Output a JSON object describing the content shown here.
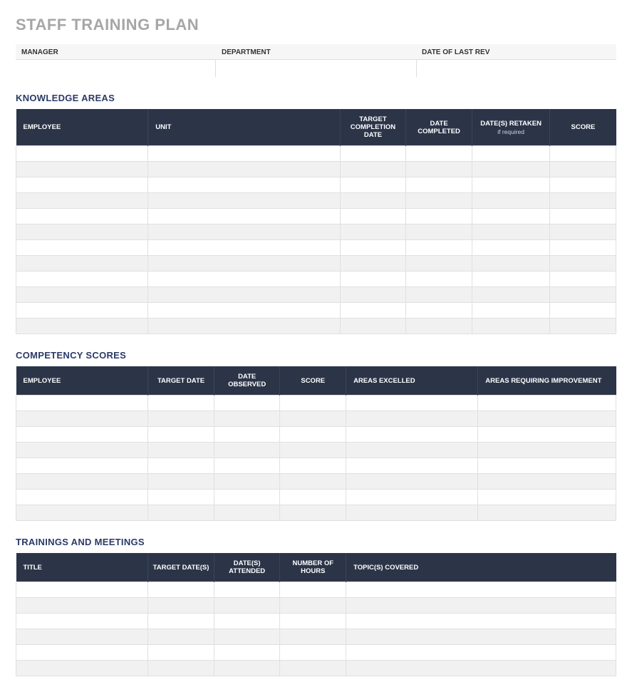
{
  "title": "STAFF TRAINING PLAN",
  "meta": {
    "manager_label": "MANAGER",
    "department_label": "DEPARTMENT",
    "date_last_rev_label": "DATE OF LAST REV",
    "manager_value": "",
    "department_value": "",
    "date_last_rev_value": ""
  },
  "knowledge": {
    "section_title": "KNOWLEDGE AREAS",
    "headers": {
      "employee": "EMPLOYEE",
      "unit": "UNIT",
      "target_completion": "TARGET COMPLETION DATE",
      "date_completed": "DATE COMPLETED",
      "dates_retaken": "DATE(S) RETAKEN",
      "dates_retaken_sub": "if required",
      "score": "SCORE"
    },
    "rows": [
      {
        "employee": "",
        "unit": "",
        "target_completion": "",
        "date_completed": "",
        "dates_retaken": "",
        "score": ""
      },
      {
        "employee": "",
        "unit": "",
        "target_completion": "",
        "date_completed": "",
        "dates_retaken": "",
        "score": ""
      },
      {
        "employee": "",
        "unit": "",
        "target_completion": "",
        "date_completed": "",
        "dates_retaken": "",
        "score": ""
      },
      {
        "employee": "",
        "unit": "",
        "target_completion": "",
        "date_completed": "",
        "dates_retaken": "",
        "score": ""
      },
      {
        "employee": "",
        "unit": "",
        "target_completion": "",
        "date_completed": "",
        "dates_retaken": "",
        "score": ""
      },
      {
        "employee": "",
        "unit": "",
        "target_completion": "",
        "date_completed": "",
        "dates_retaken": "",
        "score": ""
      },
      {
        "employee": "",
        "unit": "",
        "target_completion": "",
        "date_completed": "",
        "dates_retaken": "",
        "score": ""
      },
      {
        "employee": "",
        "unit": "",
        "target_completion": "",
        "date_completed": "",
        "dates_retaken": "",
        "score": ""
      },
      {
        "employee": "",
        "unit": "",
        "target_completion": "",
        "date_completed": "",
        "dates_retaken": "",
        "score": ""
      },
      {
        "employee": "",
        "unit": "",
        "target_completion": "",
        "date_completed": "",
        "dates_retaken": "",
        "score": ""
      },
      {
        "employee": "",
        "unit": "",
        "target_completion": "",
        "date_completed": "",
        "dates_retaken": "",
        "score": ""
      },
      {
        "employee": "",
        "unit": "",
        "target_completion": "",
        "date_completed": "",
        "dates_retaken": "",
        "score": ""
      }
    ]
  },
  "competency": {
    "section_title": "COMPETENCY SCORES",
    "headers": {
      "employee": "EMPLOYEE",
      "target_date": "TARGET DATE",
      "date_observed": "DATE OBSERVED",
      "score": "SCORE",
      "areas_excelled": "AREAS EXCELLED",
      "areas_requiring": "AREAS REQUIRING IMPROVEMENT"
    },
    "rows": [
      {
        "employee": "",
        "target_date": "",
        "date_observed": "",
        "score": "",
        "areas_excelled": "",
        "areas_requiring": ""
      },
      {
        "employee": "",
        "target_date": "",
        "date_observed": "",
        "score": "",
        "areas_excelled": "",
        "areas_requiring": ""
      },
      {
        "employee": "",
        "target_date": "",
        "date_observed": "",
        "score": "",
        "areas_excelled": "",
        "areas_requiring": ""
      },
      {
        "employee": "",
        "target_date": "",
        "date_observed": "",
        "score": "",
        "areas_excelled": "",
        "areas_requiring": ""
      },
      {
        "employee": "",
        "target_date": "",
        "date_observed": "",
        "score": "",
        "areas_excelled": "",
        "areas_requiring": ""
      },
      {
        "employee": "",
        "target_date": "",
        "date_observed": "",
        "score": "",
        "areas_excelled": "",
        "areas_requiring": ""
      },
      {
        "employee": "",
        "target_date": "",
        "date_observed": "",
        "score": "",
        "areas_excelled": "",
        "areas_requiring": ""
      },
      {
        "employee": "",
        "target_date": "",
        "date_observed": "",
        "score": "",
        "areas_excelled": "",
        "areas_requiring": ""
      }
    ]
  },
  "trainings": {
    "section_title": "TRAININGS AND MEETINGS",
    "headers": {
      "title": "TITLE",
      "target_dates": "TARGET DATE(S)",
      "dates_attended": "DATE(S) ATTENDED",
      "number_hours": "NUMBER OF HOURS",
      "topics_covered": "TOPIC(S) COVERED"
    },
    "rows": [
      {
        "title": "",
        "target_dates": "",
        "dates_attended": "",
        "number_hours": "",
        "topics_covered": ""
      },
      {
        "title": "",
        "target_dates": "",
        "dates_attended": "",
        "number_hours": "",
        "topics_covered": ""
      },
      {
        "title": "",
        "target_dates": "",
        "dates_attended": "",
        "number_hours": "",
        "topics_covered": ""
      },
      {
        "title": "",
        "target_dates": "",
        "dates_attended": "",
        "number_hours": "",
        "topics_covered": ""
      },
      {
        "title": "",
        "target_dates": "",
        "dates_attended": "",
        "number_hours": "",
        "topics_covered": ""
      },
      {
        "title": "",
        "target_dates": "",
        "dates_attended": "",
        "number_hours": "",
        "topics_covered": ""
      }
    ]
  }
}
